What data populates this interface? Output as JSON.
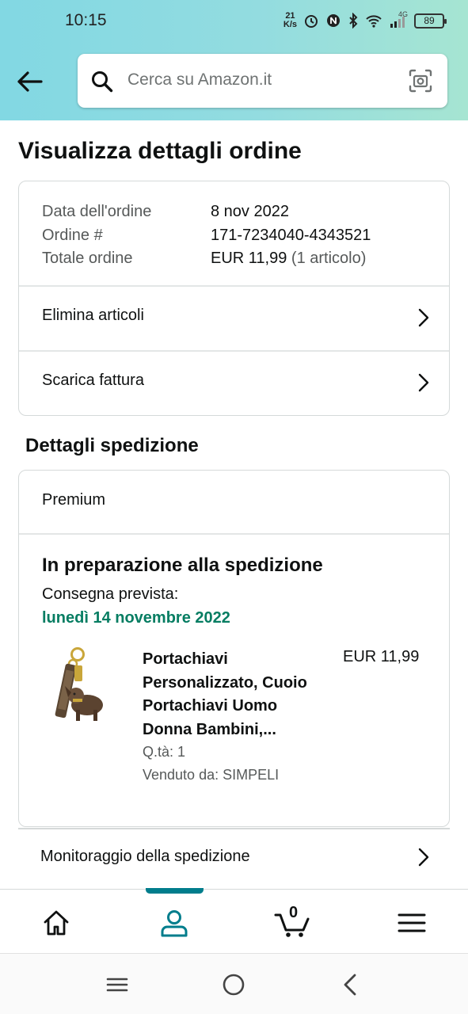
{
  "status_bar": {
    "time": "10:15",
    "net_speed_value": "21",
    "net_speed_unit": "K/s",
    "network": "4G",
    "battery": "89"
  },
  "search": {
    "placeholder": "Cerca su Amazon.it"
  },
  "page": {
    "title": "Visualizza dettagli ordine"
  },
  "order_summary": {
    "date_label": "Data dell'ordine",
    "date_value": "8 nov 2022",
    "order_label": "Ordine #",
    "order_value": "171-7234040-4343521",
    "total_label": "Totale ordine",
    "total_value": "EUR 11,99",
    "total_items": "(1 articolo)"
  },
  "actions": {
    "delete_items": "Elimina articoli",
    "download_invoice": "Scarica fattura"
  },
  "shipment": {
    "section_title": "Dettagli spedizione",
    "service": "Premium",
    "status": "In preparazione alla spedizione",
    "delivery_label": "Consegna prevista:",
    "delivery_date": "lunedì 14 novembre 2022",
    "product": {
      "title": "Portachiavi Personalizzato, Cuoio Portachiavi Uomo Donna Bambini,...",
      "price": "EUR 11,99",
      "quantity": "Q.tà: 1",
      "seller": "Venduto da: SIMPELI"
    },
    "tracking": "Monitoraggio della spedizione"
  },
  "bottom_nav": {
    "cart_count": "0"
  },
  "colors": {
    "header_gradient_start": "#82d8e3",
    "header_gradient_end": "#a6e5d2",
    "delivery_green": "#067d62",
    "active_tab": "#007d8c"
  }
}
